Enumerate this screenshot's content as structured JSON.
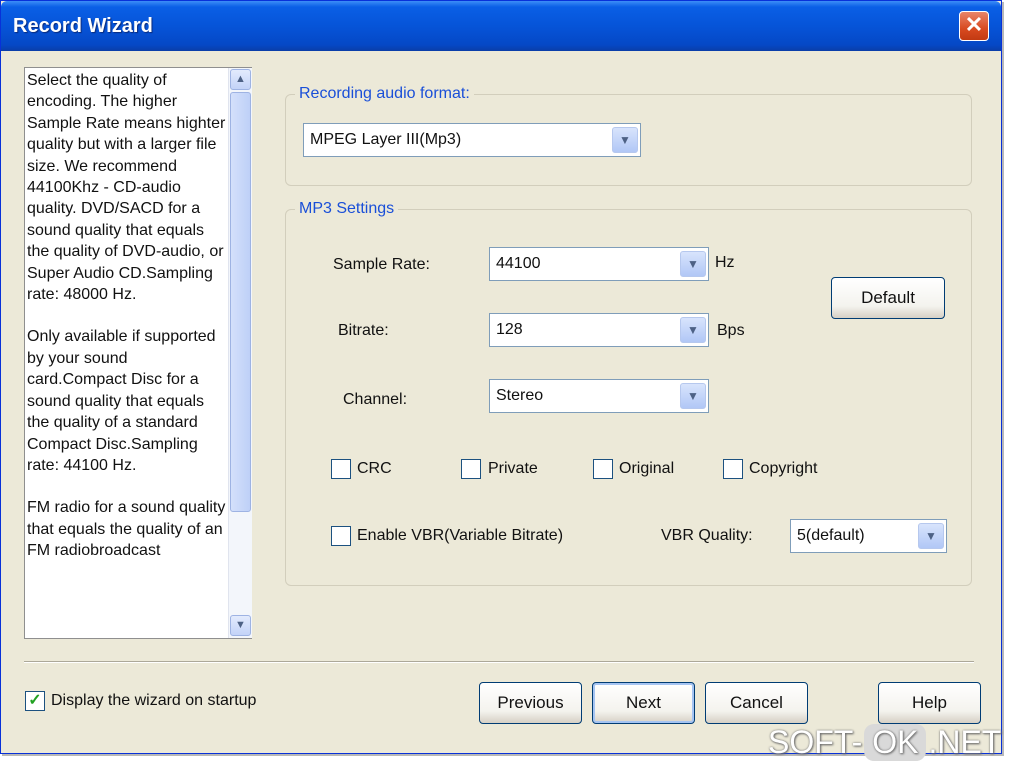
{
  "window": {
    "title": "Record Wizard",
    "close_glyph": "✕"
  },
  "help": {
    "paragraphs": [
      "Select the quality of encoding. The higher Sample Rate means highter quality but with a larger file size. We recommend 44100Khz - CD-audio quality. DVD/SACD for a sound quality that equals the quality of DVD-audio, or Super Audio CD.Sampling rate: 48000 Hz.",
      "Only available if supported by your sound card.Compact Disc for a sound quality that equals the quality of a standard Compact Disc.Sampling rate: 44100 Hz.",
      "FM radio for a sound quality that equals the quality of an FM radiobroadcast"
    ]
  },
  "format_group": {
    "legend": "Recording audio format:",
    "format_value": "MPEG Layer III(Mp3)"
  },
  "mp3_group": {
    "legend": "MP3 Settings",
    "sample_rate": {
      "label": "Sample Rate:",
      "value": "44100",
      "unit": "Hz"
    },
    "bitrate": {
      "label": "Bitrate:",
      "value": "128",
      "unit": "Bps"
    },
    "channel": {
      "label": "Channel:",
      "value": "Stereo"
    },
    "default_button": "Default",
    "checkboxes": {
      "crc": {
        "label": "CRC",
        "checked": false
      },
      "private": {
        "label": "Private",
        "checked": false
      },
      "original": {
        "label": "Original",
        "checked": false
      },
      "copyright": {
        "label": "Copyright",
        "checked": false
      },
      "vbr": {
        "label": "Enable VBR(Variable Bitrate)",
        "checked": false
      }
    },
    "vbr_quality": {
      "label": "VBR Quality:",
      "value": "5(default)"
    }
  },
  "footer": {
    "startup_checkbox": {
      "label": "Display the wizard on startup",
      "checked": true,
      "glyph": "✓"
    },
    "previous": "Previous",
    "next": "Next",
    "cancel": "Cancel",
    "help": "Help"
  },
  "icons": {
    "dropdown": "▼",
    "scroll_up": "▲",
    "scroll_down": "▼"
  },
  "watermark": {
    "left": "SOFT-",
    "mid": "OK",
    "right": ".NET"
  }
}
